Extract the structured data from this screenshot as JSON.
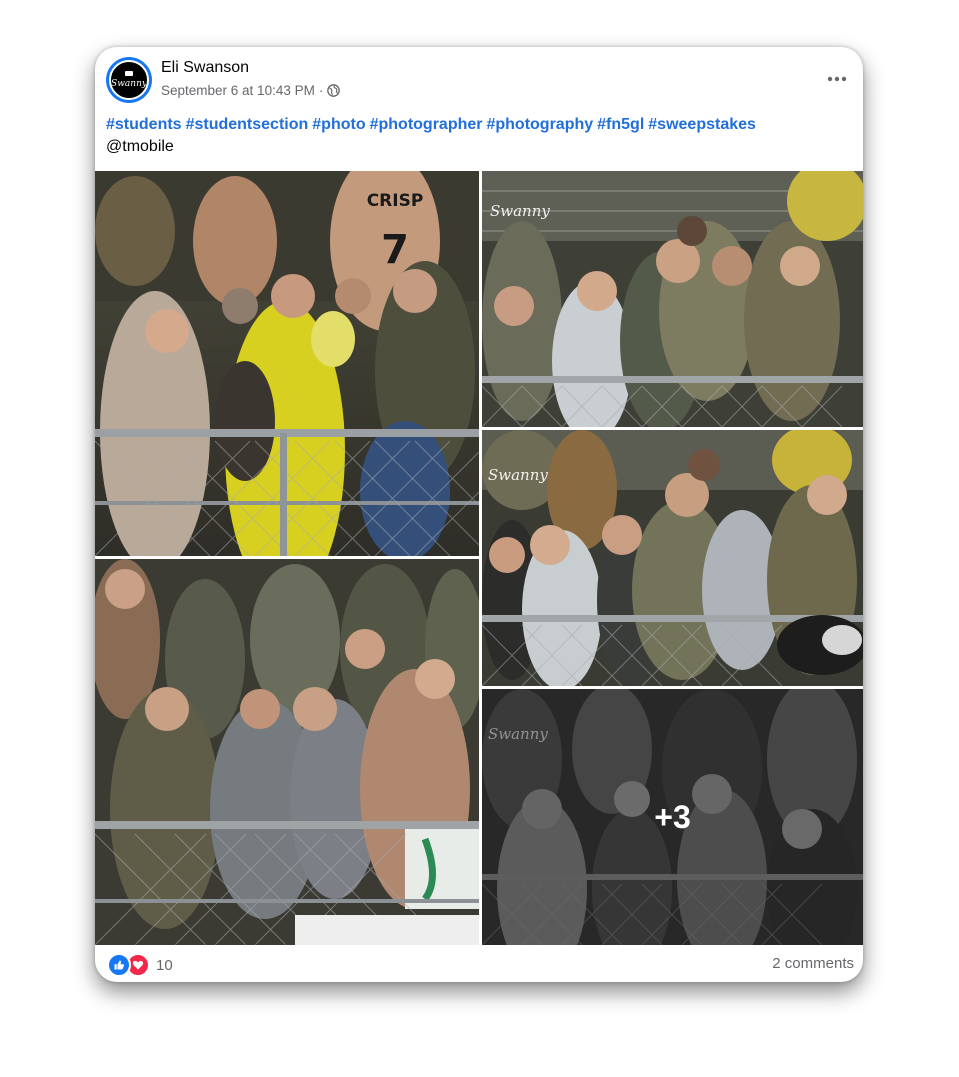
{
  "post": {
    "author": "Eli Swanson",
    "timestamp": "September 6 at 10:43 PM",
    "separator": "·",
    "privacy_icon": "globe-icon",
    "more_icon": "more-horizontal-icon",
    "avatar_text": "Swanny",
    "hashtags": [
      "#students",
      "#studentsection",
      "#photo",
      "#photographer",
      "#photography",
      "#fn5gl",
      "#sweepstakes"
    ],
    "mention": "@tmobile"
  },
  "photos": {
    "watermark": "Swanny",
    "overlay_count": "+3",
    "jersey_text": "CRISP",
    "jersey_number": "7"
  },
  "reactions": {
    "icons": [
      "like-icon",
      "love-icon"
    ],
    "count": "10",
    "comments_label": "2 comments"
  },
  "colors": {
    "link_blue": "#216fdb",
    "like_blue": "#1877f2",
    "love_red": "#f02849",
    "meta_grey": "#65676b"
  }
}
